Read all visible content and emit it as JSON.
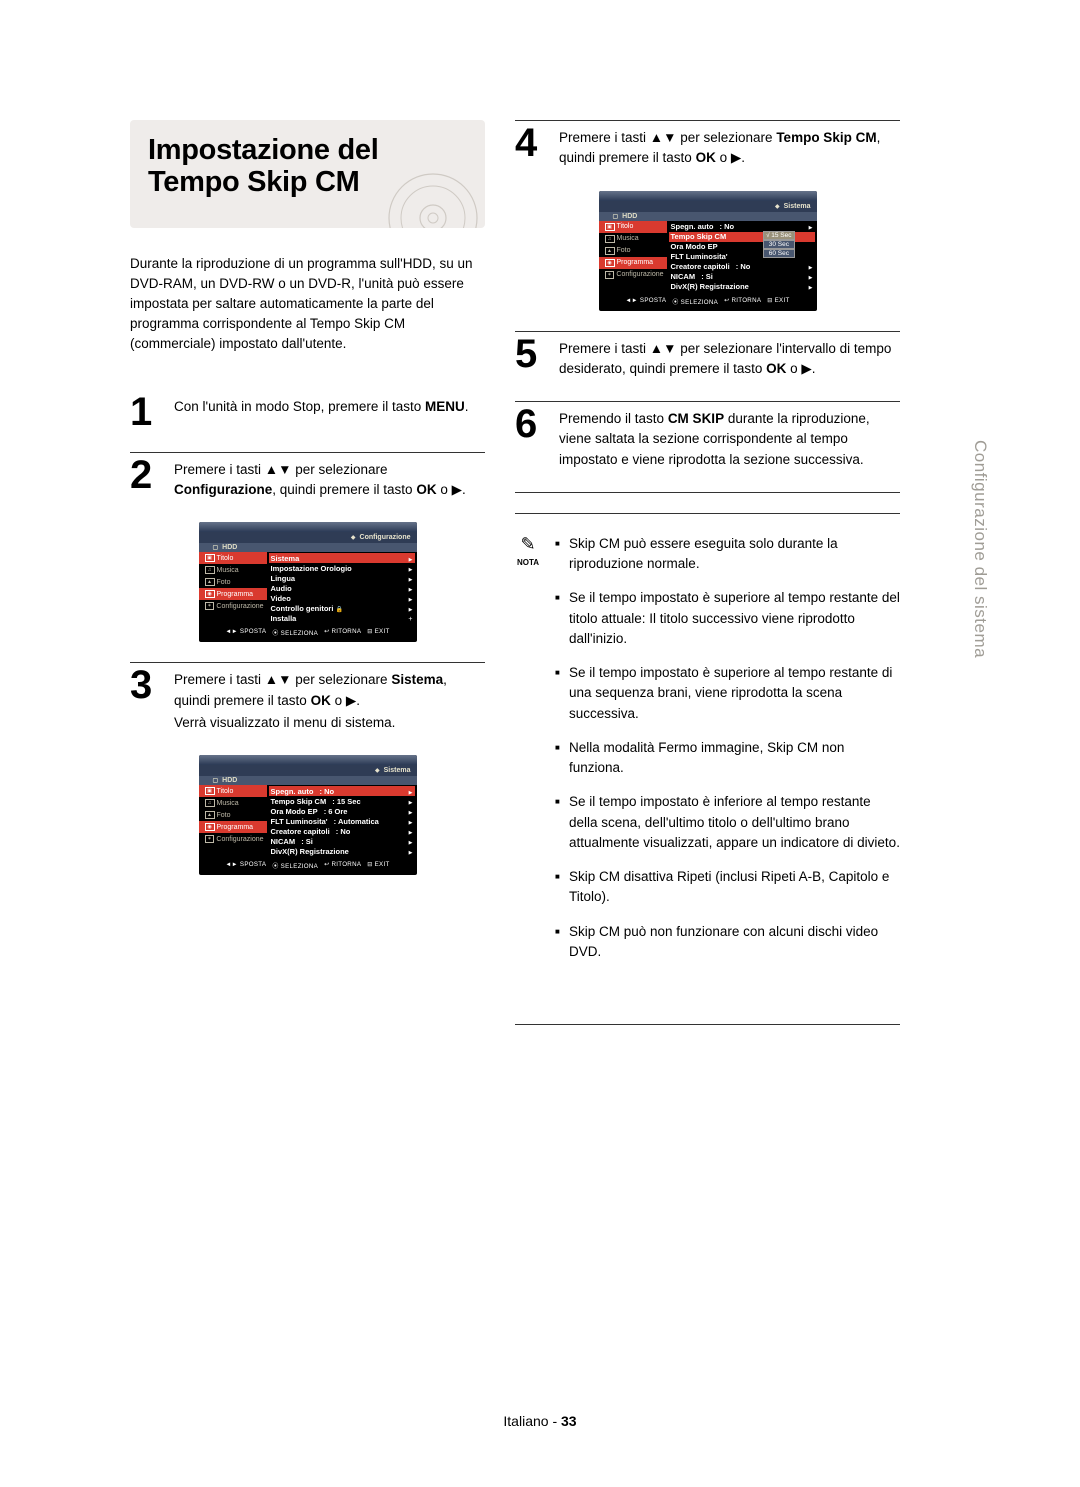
{
  "title": "Impostazione del Tempo Skip CM",
  "intro": "Durante la riproduzione di un programma sull'HDD, su un DVD-RAM, un DVD-RW o un DVD-R, l'unità può essere impostata per saltare automaticamente la parte del programma corrispondente al Tempo Skip CM (commerciale) impostato dall'utente.",
  "steps": {
    "s1": {
      "num": "1",
      "text_a": "Con l'unità in modo Stop, premere il tasto ",
      "bold_a": "MENU",
      "text_b": "."
    },
    "s2": {
      "num": "2",
      "text_a": "Premere i tasti ▲▼ per selezionare ",
      "bold_a": "Configurazione",
      "text_b": ", quindi premere il tasto ",
      "bold_b": "OK",
      "text_c": " o ▶."
    },
    "s3": {
      "num": "3",
      "text_a": "Premere i tasti ▲▼ per selezionare ",
      "bold_a": "Sistema",
      "text_b": ", quindi premere il tasto ",
      "bold_b": "OK",
      "text_c": " o ▶.",
      "sub": "Verrà visualizzato il menu di sistema."
    },
    "s4": {
      "num": "4",
      "text_a": "Premere i tasti ▲▼ per selezionare ",
      "bold_a": "Tempo Skip CM",
      "text_b": ", quindi premere il tasto ",
      "bold_b": "OK",
      "text_c": " o ▶."
    },
    "s5": {
      "num": "5",
      "text_a": "Premere i tasti ▲▼ per selezionare l'intervallo di tempo desiderato, quindi premere il tasto ",
      "bold_a": "OK",
      "text_b": " o ▶."
    },
    "s6": {
      "num": "6",
      "text_a": "Premendo il tasto ",
      "bold_a": "CM SKIP",
      "text_b": " durante la riproduzione, viene saltata la sezione corrispondente al tempo impostato e viene riprodotta la sezione successiva."
    }
  },
  "osd_common": {
    "hdd": "HDD",
    "side_titolo": "Titolo",
    "side_musica": "Musica",
    "side_foto": "Foto",
    "side_programma": "Programma",
    "side_config": "Configurazione",
    "foot_sposta": "SPOSTA",
    "foot_seleziona": "SELEZIONA",
    "foot_ritorna": "RITORNA",
    "foot_exit": "EXIT"
  },
  "osd2": {
    "title": "Configurazione",
    "rows": [
      {
        "label": "Sistema",
        "val": "",
        "on": true
      },
      {
        "label": "Impostazione Orologio",
        "val": ""
      },
      {
        "label": "Lingua",
        "val": ""
      },
      {
        "label": "Audio",
        "val": ""
      },
      {
        "label": "Video",
        "val": ""
      },
      {
        "label": "Controllo genitori",
        "val": "",
        "lock": true
      },
      {
        "label": "Installa",
        "val": ""
      }
    ]
  },
  "osd3": {
    "title": "Sistema",
    "rows": [
      {
        "label": "Spegn. auto",
        "val": ": No",
        "on": true
      },
      {
        "label": "Tempo Skip CM",
        "val": ": 15 Sec"
      },
      {
        "label": "Ora Modo EP",
        "val": ": 6 Ore"
      },
      {
        "label": "FLT Luminosita'",
        "val": ": Automatica"
      },
      {
        "label": "Creatore capitoli",
        "val": ": No"
      },
      {
        "label": "NICAM",
        "val": ": Si"
      },
      {
        "label": "DivX(R) Registrazione",
        "val": ""
      }
    ]
  },
  "osd4": {
    "title": "Sistema",
    "rows": [
      {
        "label": "Spegn. auto",
        "val": ": No"
      },
      {
        "label": "Tempo Skip CM",
        "val": "",
        "on": true
      },
      {
        "label": "Ora Modo EP",
        "val": ""
      },
      {
        "label": "FLT Luminosita'",
        "val": ""
      },
      {
        "label": "Creatore capitoli",
        "val": ": No"
      },
      {
        "label": "NICAM",
        "val": ": Si"
      },
      {
        "label": "DivX(R) Registrazione",
        "val": ""
      }
    ],
    "options": [
      "15 Sec",
      "30 Sec",
      "60 Sec"
    ]
  },
  "nota": {
    "label": "NOTA",
    "items": [
      "Skip CM può essere eseguita solo durante la riproduzione normale.",
      "Se il tempo impostato è superiore al tempo restante del titolo attuale: Il titolo successivo viene riprodotto dall'inizio.",
      "Se il tempo impostato è superiore al tempo restante di una sequenza brani, viene riprodotta la scena successiva.",
      "Nella modalità Fermo immagine, Skip CM non funziona.",
      "Se il tempo impostato è inferiore al tempo restante della scena, dell'ultimo titolo o dell'ultimo brano attualmente visualizzati, appare un indicatore di divieto.",
      "Skip CM disattiva Ripeti (inclusi Ripeti A-B, Capitolo e Titolo).",
      "Skip CM può non funzionare con alcuni dischi video DVD."
    ]
  },
  "side_tab": "Configurazione del sistema",
  "footer_lang": "Italiano",
  "footer_sep": " - ",
  "footer_page": "33"
}
